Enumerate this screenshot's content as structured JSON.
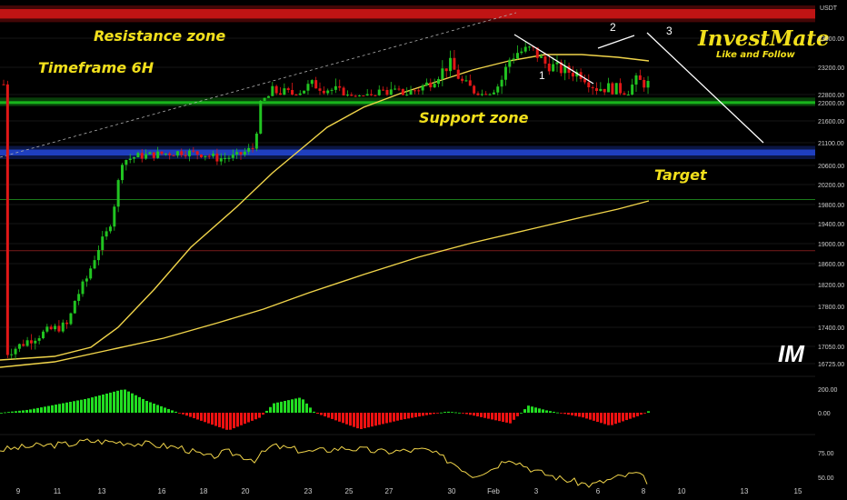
{
  "chart_data": {
    "type": "candlestick",
    "currency_label": "USDT",
    "timeframe_text": "Timeframe 6H",
    "price_scale": {
      "ticks": [
        "23600.00",
        "23200.00",
        "22800.00",
        "22000.00",
        "21600.00",
        "21100.00",
        "20600.00",
        "20200.00",
        "19800.00",
        "19400.00",
        "19000.00",
        "18600.00",
        "18200.00",
        "17800.00",
        "17400.00",
        "17050.00",
        "16725.00"
      ],
      "ylim": [
        16500,
        24100
      ]
    },
    "x_axis": {
      "labels": [
        "9",
        "11",
        "13",
        "16",
        "18",
        "20",
        "23",
        "25",
        "27",
        "30",
        "Feb",
        "3",
        "6",
        "8",
        "10",
        "13",
        "15"
      ]
    },
    "zones": {
      "resistance": {
        "label": "Resistance zone",
        "low": 23870,
        "high": 24000,
        "color": "#c01414"
      },
      "support": {
        "label": "Support zone",
        "low": 22030,
        "high": 22150,
        "color": "#18b41c"
      },
      "blue_band": {
        "low": 20820,
        "high": 20950,
        "color": "#1f3fbf"
      },
      "target": {
        "label": "Target",
        "price": 19900,
        "color": "#1a7a1a"
      },
      "red_line": {
        "price": 18860,
        "color": "#7a1a1a"
      }
    },
    "wave_labels": [
      "1",
      "2",
      "3"
    ],
    "candles_summary": {
      "start_price": 16900,
      "rally_top": 20950,
      "breakout_high": 23100,
      "peak_high": 23950,
      "last_close": 22950
    },
    "ma_colors": {
      "fast": "#f0d44a",
      "slow": "#f0d44a"
    },
    "macd": {
      "ticks": [
        "200.00",
        "0.00"
      ],
      "ylim": [
        -260,
        300
      ],
      "pos_color": "#22dd22",
      "neg_color": "#ee1111"
    },
    "rsi": {
      "ticks": [
        "75.00",
        "50.00"
      ],
      "ylim": [
        38,
        92
      ],
      "color": "#f0d44a"
    }
  },
  "brand": {
    "name": "InvestMate",
    "tagline": "Like and Follow",
    "logo_text": "IM"
  }
}
